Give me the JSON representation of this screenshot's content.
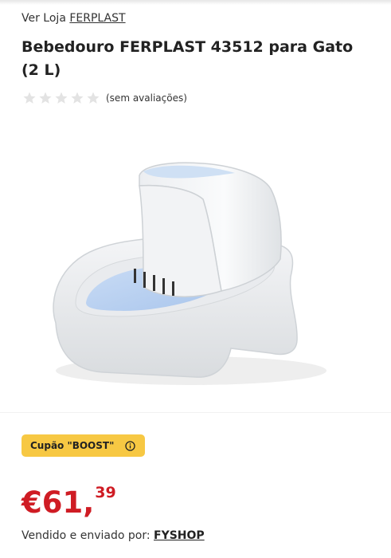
{
  "store": {
    "prefix": "Ver Loja",
    "name": "FERPLAST"
  },
  "product": {
    "title": "Bebedouro FERPLAST 43512 para Gato (2 L)",
    "rating": {
      "stars_filled": 0,
      "stars_total": 5,
      "text": "(sem avaliações)"
    },
    "image_icon": "cat-water-fountain-image"
  },
  "coupon": {
    "label": "Cupão \"BOOST\"",
    "icon": "info-icon"
  },
  "price": {
    "integer": "€61,",
    "cents": "39"
  },
  "seller": {
    "prefix": "Vendido e enviado por:",
    "name": "FYSHOP"
  },
  "colors": {
    "price": "#cf1c24",
    "coupon_bg": "#f7c843",
    "star_empty": "#e3e3e3",
    "water": "#b9d3f2"
  }
}
